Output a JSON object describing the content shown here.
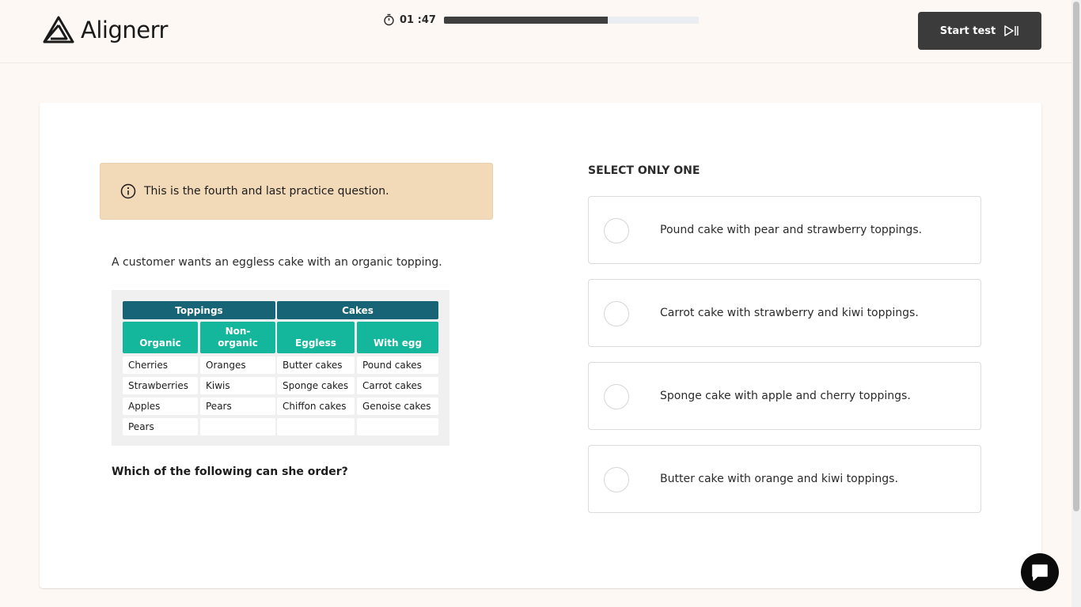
{
  "header": {
    "logo_text": "Alignerr",
    "timer": "01 :47",
    "progress_fraction": 0.643,
    "start_button_label": "Start test"
  },
  "info": {
    "text": "This is the fourth and last practice question."
  },
  "prompt": "A customer wants an eggless cake with an organic topping.",
  "question": "Which of the following can she order?",
  "table": {
    "groups": [
      "Toppings",
      "Cakes"
    ],
    "columns": [
      {
        "line1": "Organic",
        "line2": ""
      },
      {
        "line1": "Non-",
        "line2": "organic"
      },
      {
        "line1": "Eggless",
        "line2": ""
      },
      {
        "line1": "With egg",
        "line2": ""
      }
    ],
    "rows": [
      [
        "Cherries",
        "Oranges",
        "Butter cakes",
        "Pound cakes"
      ],
      [
        "Strawberries",
        "Kiwis",
        "Sponge cakes",
        "Carrot cakes"
      ],
      [
        "Apples",
        "Pears",
        "Chiffon cakes",
        "Genoise cakes"
      ],
      [
        "Pears",
        "",
        "",
        ""
      ]
    ]
  },
  "answers": {
    "label": "SELECT ONLY ONE",
    "options": [
      "Pound cake with pear and strawberry toppings.",
      "Carrot cake with strawberry and kiwi toppings.",
      "Sponge cake with apple and cherry toppings.",
      "Butter cake with orange and kiwi toppings."
    ]
  },
  "colors": {
    "accent_dark": "#176476",
    "accent_teal": "#14b79c",
    "info_bg": "#f2d9b8",
    "button_bg": "#3b3b3b"
  }
}
